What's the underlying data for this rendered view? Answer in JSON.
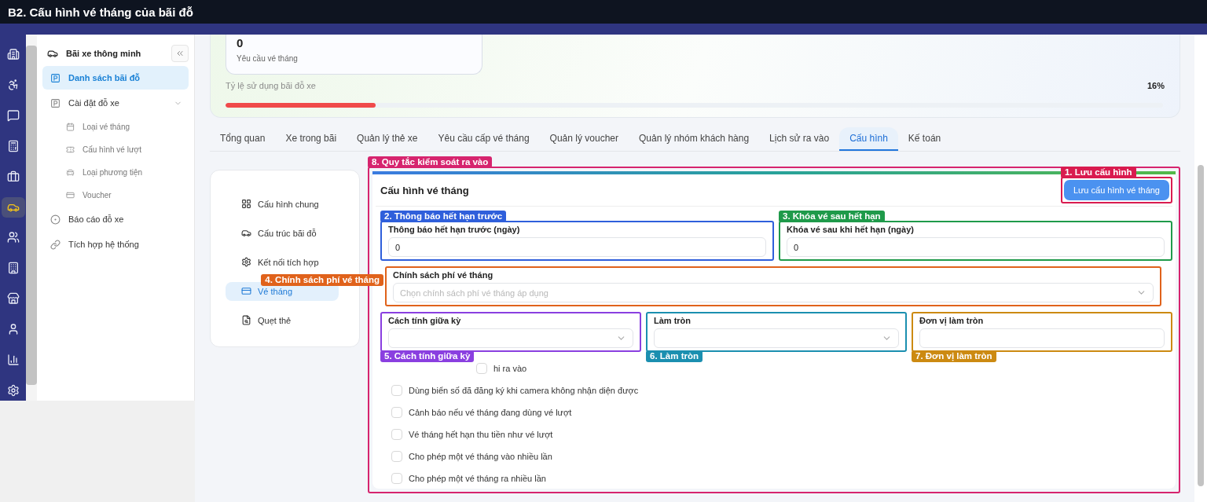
{
  "header": {
    "title": "B2. Cấu hình vé tháng của bãi đỗ"
  },
  "rail": [
    {
      "selected": false
    },
    {
      "selected": false
    },
    {
      "selected": false
    },
    {
      "selected": false
    },
    {
      "selected": false
    },
    {
      "selected": true
    },
    {
      "selected": false
    },
    {
      "selected": false
    },
    {
      "selected": false
    },
    {
      "selected": false
    },
    {
      "selected": false
    },
    {
      "selected": false
    }
  ],
  "sidebar": {
    "title": "Bãi xe thông minh",
    "items": [
      {
        "label": "Danh sách bãi đỗ",
        "selected": true
      },
      {
        "label": "Cài đặt đỗ xe",
        "selected": false,
        "expanded": true,
        "children": [
          {
            "label": "Loại vé tháng",
            "selected": false
          },
          {
            "label": "Cấu hình vé lượt",
            "selected": false
          },
          {
            "label": "Loại phương tiện",
            "selected": false
          },
          {
            "label": "Voucher",
            "selected": false
          }
        ]
      },
      {
        "label": "Báo cáo đỗ xe",
        "selected": false
      },
      {
        "label": "Tích hợp hệ thống",
        "selected": false
      }
    ]
  },
  "stats": {
    "count": "0",
    "count_label": "Yêu cầu vé tháng",
    "usage_label": "Tỷ lệ sử dụng bãi đỗ xe",
    "usage_value": "16%",
    "level": 0.16
  },
  "tabs": [
    {
      "label": "Tổng quan",
      "selected": false
    },
    {
      "label": "Xe trong bãi",
      "selected": false
    },
    {
      "label": "Quản lý thẻ xe",
      "selected": false
    },
    {
      "label": "Yêu cầu cấp vé tháng",
      "selected": false
    },
    {
      "label": "Quản lý voucher",
      "selected": false
    },
    {
      "label": "Quản lý nhóm khách hàng",
      "selected": false
    },
    {
      "label": "Lịch sử ra vào",
      "selected": false
    },
    {
      "label": "Cấu hình",
      "selected": true
    },
    {
      "label": "Kế toán",
      "selected": false
    }
  ],
  "config_menu": [
    {
      "label": "Cấu hình chung",
      "selected": false
    },
    {
      "label": "Cấu trúc bãi đỗ",
      "selected": false
    },
    {
      "label": "Kết nối tích hợp",
      "selected": false
    },
    {
      "label": "Vé tháng",
      "selected": true
    },
    {
      "label": "Quẹt thẻ",
      "selected": false
    }
  ],
  "panel": {
    "title": "Cấu hình vé tháng",
    "annotation": {
      "label": "8. Quy tắc kiểm soát ra vào",
      "color": "#d6246e",
      "kind": "above"
    },
    "save": {
      "label": "Lưu cấu hình vé tháng",
      "annotation": {
        "label": "1. Lưu cấu hình",
        "color": "#d91b4f",
        "kind": "above"
      }
    },
    "rows": [
      [
        {
          "kind": "input",
          "label": "Thông báo hết hạn trước (ngày)",
          "value": "0",
          "annotation": {
            "label": "2. Thông báo hết hạn trước",
            "color": "#2f5fdb",
            "kind": "above"
          }
        },
        {
          "kind": "input",
          "label": "Khóa vé sau khi hết hạn (ngày)",
          "value": "0",
          "annotation": {
            "label": "3. Khóa vé sau hết hạn",
            "color": "#1f9a4a",
            "kind": "above"
          }
        }
      ],
      [
        {
          "kind": "select",
          "label": "Chính sách phí vé tháng",
          "placeholder": "Chọn chính sách phí vé tháng áp dụng",
          "annotation": {
            "label": "4. Chính sách phí vé tháng",
            "color": "#e0621b",
            "kind": "beside"
          }
        }
      ],
      [
        {
          "kind": "select",
          "label": "Cách tính giữa kỳ",
          "annotation": {
            "label": "5. Cách tính giữa kỳ",
            "color": "#8a3fe0",
            "kind": "below"
          }
        },
        {
          "kind": "select",
          "label": "Làm tròn",
          "annotation": {
            "label": "6. Làm tròn",
            "color": "#1b8fb0",
            "kind": "below"
          }
        },
        {
          "kind": "input",
          "label": "Đơn vị làm tròn",
          "annotation": {
            "label": "7. Đơn vị làm tròn",
            "color": "#cc8a12",
            "kind": "below"
          }
        }
      ]
    ],
    "options": [
      {
        "label": "hi ra vào",
        "checked": false
      },
      {
        "label": "Dùng biển số đã đăng ký khi camera không nhận diện được",
        "checked": false
      },
      {
        "label": "Cảnh báo nếu vé tháng đang dùng vé lượt",
        "checked": false
      },
      {
        "label": "Vé tháng hết hạn thu tiền như vé lượt",
        "checked": false
      },
      {
        "label": "Cho phép một vé tháng vào nhiều lần",
        "checked": false
      },
      {
        "label": "Cho phép một vé tháng ra nhiều lần",
        "checked": false
      }
    ]
  }
}
